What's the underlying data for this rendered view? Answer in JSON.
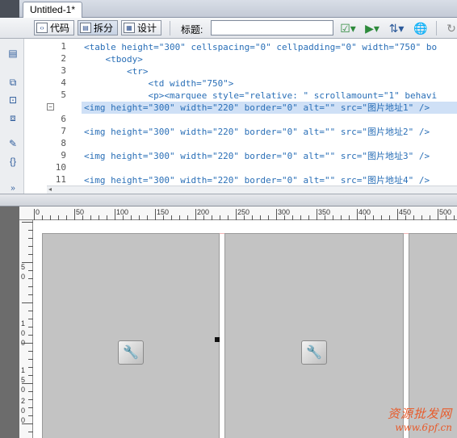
{
  "document": {
    "tab_title": "Untitled-1*"
  },
  "toolbar": {
    "code_label": "代码",
    "split_label": "拆分",
    "design_label": "设计",
    "title_label": "标题:",
    "title_value": ""
  },
  "icons": {
    "code_view": "code-view-icon",
    "split_view": "split-view-icon",
    "design_view": "design-view-icon",
    "browser_check": "browser-check-icon",
    "preview": "preview-icon",
    "file_management": "file-management-icon",
    "globe": "globe-icon",
    "refresh": "refresh-icon",
    "image_placeholder": "image-placeholder-icon"
  },
  "editor": {
    "line_numbers": [
      "1",
      "2",
      "3",
      "4",
      "5",
      "6",
      "7",
      "8",
      "9",
      "10",
      "11"
    ],
    "lines": [
      "<table height=\"300\" cellspacing=\"0\" cellpadding=\"0\" width=\"750\" bo",
      "    <tbody>",
      "        <tr>",
      "            <td width=\"750\">",
      "            <p><marquee style=\"relative: \" scrollamount=\"1\" behavi",
      "<img height=\"300\" width=\"220\" border=\"0\" alt=\"\" src=\"图片地址1\" />",
      "",
      "<img height=\"300\" width=\"220\" border=\"0\" alt=\"\" src=\"图片地址2\" />",
      "",
      "",
      "<img height=\"300\" width=\"220\" border=\"0\" alt=\"\" src=\"图片地址3\" />",
      "",
      "<img height=\"300\" width=\"220\" border=\"0\" alt=\"\" src=\"图片地址4\" />"
    ],
    "highlighted_line": 6
  },
  "ruler": {
    "h_labels": [
      "0",
      "50",
      "100",
      "150",
      "200",
      "250",
      "300",
      "350",
      "400",
      "450",
      "500"
    ],
    "v_labels": [
      "5",
      "0",
      "1",
      "0",
      "0",
      "1",
      "5",
      "0",
      "2",
      "0",
      "0"
    ]
  },
  "watermark": {
    "line1": "资源批发网",
    "line2": "www.6pf.cn"
  },
  "colors": {
    "code_attr": "#2a6fb7",
    "selection": "#cfe0f6",
    "placeholder": "#c3c3c3",
    "watermark": "#e85b2b"
  }
}
